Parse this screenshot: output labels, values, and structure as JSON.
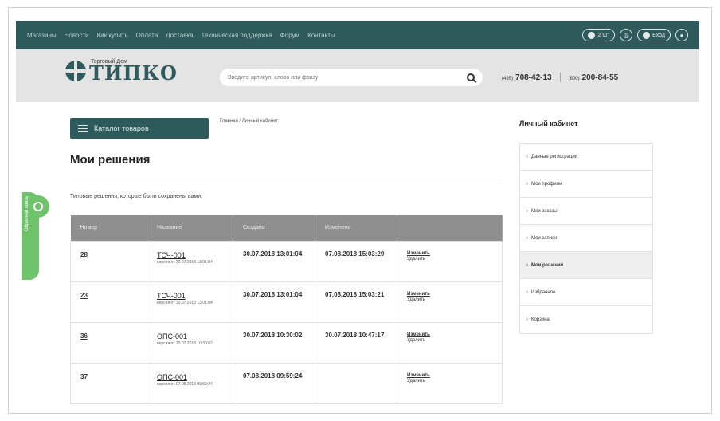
{
  "topbar": {
    "nav": [
      "Магазины",
      "Новости",
      "Как купить",
      "Оплата",
      "Доставка",
      "Техническая поддержка",
      "Форум",
      "Контакты"
    ],
    "cart_label": "2 шт",
    "login_label": "Вход"
  },
  "header": {
    "logo_small": "Торговый Дом",
    "logo_big": "ТИПКО",
    "search_placeholder": "Введите артикул, слово или фразу",
    "phone1_code": "(495)",
    "phone1_number": "708-42-13",
    "phone2_code": "(800)",
    "phone2_number": "200-84-55"
  },
  "catalog_label": "Каталог товаров",
  "breadcrumb": "Главная / Личный кабинет",
  "page_title": "Мои решения",
  "intro": "Типовые решения, которые были сохранены вами.",
  "table": {
    "headers": [
      "Номер",
      "Название",
      "Создано",
      "Изменено",
      ""
    ],
    "rows": [
      {
        "num": "28",
        "name": "ТСЧ-001",
        "sub": "версия от 30.07.2018 13:01:04",
        "created": "30.07.2018 13:01:04",
        "modified": "07.08.2018 15:03:29",
        "a1": "Изменить",
        "a2": "Удалить"
      },
      {
        "num": "23",
        "name": "ТСЧ-001",
        "sub": "версия от 30.07.2018 13:01:04",
        "created": "30.07.2018 13:01:04",
        "modified": "07.08.2018 15:03:21",
        "a1": "Изменить",
        "a2": "Удалить"
      },
      {
        "num": "36",
        "name": "ОПС-001",
        "sub": "версия от 30.07.2018 10:30:02",
        "created": "30.07.2018 10:30:02",
        "modified": "30.07.2018 10:47:17",
        "a1": "Изменить",
        "a2": "Удалить"
      },
      {
        "num": "37",
        "name": "ОПС-001",
        "sub": "версия от 07.08.2018 09:59:24",
        "created": "07.08.2018 09:59:24",
        "modified": "",
        "a1": "Изменить",
        "a2": "Удалить"
      }
    ]
  },
  "sidebar": {
    "title": "Личный кабинет",
    "items": [
      "Данные регистрации",
      "Мои профили",
      "Мои заказы",
      "Мои записи",
      "Мои решения",
      "Избранное",
      "Корзина"
    ],
    "active_index": 4
  },
  "feedback_label": "Обратная связь",
  "colors": {
    "brand": "#2e5a5c",
    "header_bg": "#e4e4e4",
    "table_head": "#8f8f8f",
    "feedback": "#6fc46b"
  }
}
